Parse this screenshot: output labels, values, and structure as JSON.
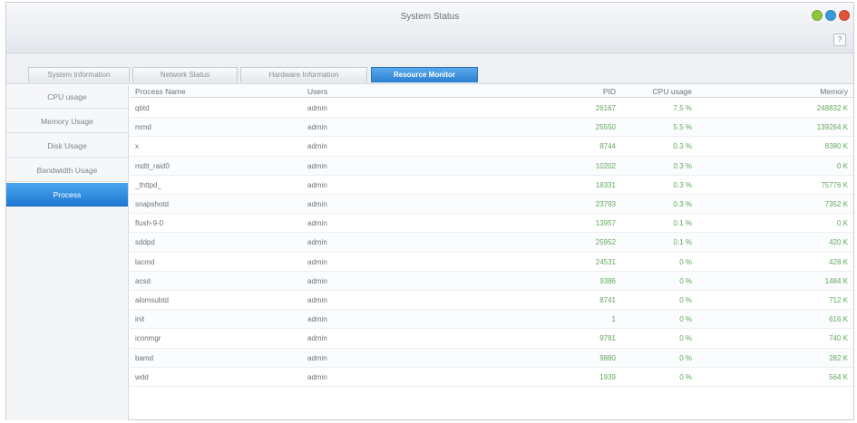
{
  "window": {
    "title": "System Status",
    "help_label": "?",
    "buttons": [
      {
        "name": "minimize-button",
        "color": "#8cc63f"
      },
      {
        "name": "maximize-button",
        "color": "#3a9ad9"
      },
      {
        "name": "close-button",
        "color": "#e2533a"
      }
    ]
  },
  "tabs": [
    {
      "label": "System Information"
    },
    {
      "label": "Network Status"
    },
    {
      "label": "Hardware Information"
    },
    {
      "label": "Resource Monitor",
      "active": true
    }
  ],
  "sidebar": {
    "items": [
      {
        "label": "CPU usage"
      },
      {
        "label": "Memory Usage"
      },
      {
        "label": "Disk Usage"
      },
      {
        "label": "Bandwidth Usage"
      },
      {
        "label": "Process",
        "active": true
      }
    ]
  },
  "table": {
    "headers": {
      "name": "Process Name",
      "users": "Users",
      "pid": "PID",
      "cpu": "CPU usage",
      "memory": "Memory"
    },
    "rows": [
      {
        "name": "qbtd",
        "user": "admin",
        "pid": "26167",
        "cpu": "7.5 %",
        "memory": "248832 K"
      },
      {
        "name": "mmd",
        "user": "admin",
        "pid": "25550",
        "cpu": "5.5 %",
        "memory": "139264 K"
      },
      {
        "name": "x",
        "user": "admin",
        "pid": "8744",
        "cpu": "0.3 %",
        "memory": "8380 K"
      },
      {
        "name": "mdtt_raid0",
        "user": "admin",
        "pid": "10202",
        "cpu": "0.3 %",
        "memory": "0 K"
      },
      {
        "name": "_thttpd_",
        "user": "admin",
        "pid": "18331",
        "cpu": "0.3 %",
        "memory": "75776 K"
      },
      {
        "name": "snapshotd",
        "user": "admin",
        "pid": "23793",
        "cpu": "0.3 %",
        "memory": "7352 K"
      },
      {
        "name": "flush-9-0",
        "user": "admin",
        "pid": "13957",
        "cpu": "0.1 %",
        "memory": "0 K"
      },
      {
        "name": "sddpd",
        "user": "admin",
        "pid": "25952",
        "cpu": "0.1 %",
        "memory": "420 K"
      },
      {
        "name": "lacmd",
        "user": "admin",
        "pid": "24531",
        "cpu": "0 %",
        "memory": "428 K"
      },
      {
        "name": "acsd",
        "user": "admin",
        "pid": "9386",
        "cpu": "0 %",
        "memory": "1484 K"
      },
      {
        "name": "alomsubtd",
        "user": "admin",
        "pid": "8741",
        "cpu": "0 %",
        "memory": "712 K"
      },
      {
        "name": "init",
        "user": "admin",
        "pid": "1",
        "cpu": "0 %",
        "memory": "616 K"
      },
      {
        "name": "iconmgr",
        "user": "admin",
        "pid": "9781",
        "cpu": "0 %",
        "memory": "740 K"
      },
      {
        "name": "bamd",
        "user": "admin",
        "pid": "9880",
        "cpu": "0 %",
        "memory": "282 K"
      },
      {
        "name": "wdd",
        "user": "admin",
        "pid": "1939",
        "cpu": "0 %",
        "memory": "564 K"
      }
    ]
  }
}
